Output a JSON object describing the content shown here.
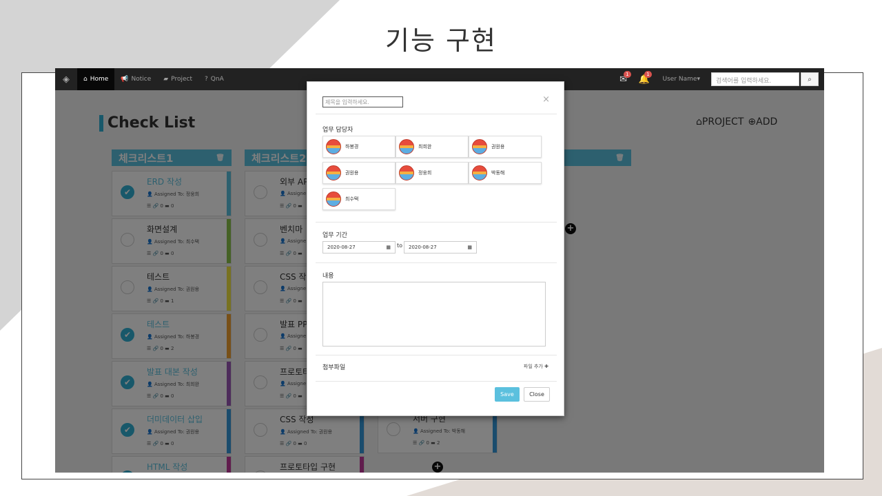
{
  "slide": {
    "title": "기능 구현"
  },
  "navbar": {
    "brand_icon": "layers-icon",
    "items": [
      {
        "label": "Home",
        "icon": "home-icon",
        "active": true
      },
      {
        "label": "Notice",
        "icon": "bullhorn-icon",
        "active": false
      },
      {
        "label": "Project",
        "icon": "folder-open-icon",
        "active": false
      },
      {
        "label": "QnA",
        "icon": "question-circle-icon",
        "active": false
      }
    ],
    "mail_badge": "1",
    "bell_badge": "1",
    "user": "User Name",
    "search_placeholder": "검색어를 입력하세요."
  },
  "page": {
    "title": "Check List",
    "project_label": "PROJECT",
    "add_label": "ADD"
  },
  "columns": [
    {
      "title": "체크리스트1"
    },
    {
      "title": "체크리스트2"
    }
  ],
  "cards_col1": [
    {
      "title": "ERD 작성",
      "assigned": "Assigned To: 정웅희",
      "meta": "☰ 🔗 0 ▬ 0",
      "done": true,
      "color": "#5bc0de"
    },
    {
      "title": "화면설계",
      "assigned": "Assigned To: 최수택",
      "meta": "☰ 🔗 0 ▬ 0",
      "done": false,
      "color": "#8bc34a"
    },
    {
      "title": "테스트",
      "assigned": "Assigned To: 권원용",
      "meta": "☰ 🔗 0 ▬ 1",
      "done": false,
      "color": "#f0e442"
    },
    {
      "title": "테스트",
      "assigned": "Assigned To: 하봉경",
      "meta": "☰ 🔗 0 ▬ 2",
      "done": true,
      "color": "#f0a030"
    },
    {
      "title": "발표 대본 작성",
      "assigned": "Assigned To: 최희완",
      "meta": "☰ 🔗 0 ▬ 0",
      "done": true,
      "color": "#9b59b6"
    },
    {
      "title": "더미데이터 삽입",
      "assigned": "Assigned To: 권원용",
      "meta": "☰ 🔗 0 ▬ 0",
      "done": true,
      "color": "#3498db"
    },
    {
      "title": "HTML 작성",
      "assigned": "",
      "meta": "",
      "done": true,
      "color": "#c0399b"
    }
  ],
  "cards_col2": [
    {
      "title": "외부 AP",
      "assigned": "Assigne",
      "meta": "☰ 🔗 0 ▬",
      "done": false,
      "color": "#3498db"
    },
    {
      "title": "벤치마",
      "assigned": "Assigne",
      "meta": "☰ 🔗 0 ▬",
      "done": false,
      "color": "#3498db"
    },
    {
      "title": "CSS 작",
      "assigned": "Assigne",
      "meta": "☰ 🔗 0 ▬",
      "done": false,
      "color": "#3498db"
    },
    {
      "title": "발표 PP",
      "assigned": "Assigne",
      "meta": "☰ 🔗 0 ▬",
      "done": false,
      "color": "#3498db"
    },
    {
      "title": "프로토타",
      "assigned": "Assigne",
      "meta": "☰ 🔗 0 ▬",
      "done": false,
      "color": "#3498db"
    },
    {
      "title": "CSS 작성",
      "assigned": "Assigned To: 권원용",
      "meta": "☰ 🔗 0 ▬ 0",
      "done": false,
      "color": "#3498db"
    },
    {
      "title": "프로토타입 구현",
      "assigned": "",
      "meta": "",
      "done": false,
      "color": "#c0399b"
    }
  ],
  "card_col3": {
    "title": "서버 구현",
    "assigned": "Assigned To: 박동해",
    "meta": "☰ 🔗 0 ▬ 2",
    "done": false,
    "color": "#3498db"
  },
  "modal": {
    "title_placeholder": "제목을 입력하세요.",
    "close_symbol": "×",
    "assignee_label": "업무 담당자",
    "assignees": [
      "하봉경",
      "최희완",
      "권원용",
      "권원용",
      "정웅희",
      "박동해",
      "최수택"
    ],
    "period_label": "업무 기간",
    "start_date": "2020-08-27",
    "to": "to",
    "end_date": "2020-08-27",
    "content_label": "내용",
    "attach_label": "첨부파일",
    "add_file": "파일 추가",
    "save": "Save",
    "close": "Close"
  }
}
